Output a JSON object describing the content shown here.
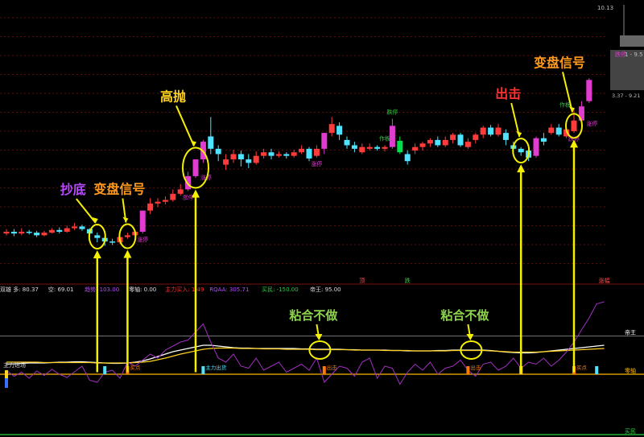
{
  "chart_data": [
    {
      "type": "candlestick",
      "panel": "price",
      "top_right_price": "10.13",
      "axis_box_text": "3.37 - 9.21",
      "axis_box_tag": "跌停",
      "axis_box_value": "1 - 9.5",
      "candles": [
        {
          "o": 9.0,
          "c": 9.02,
          "h": 9.05,
          "l": 8.98
        },
        {
          "o": 9.02,
          "c": 9.0,
          "h": 9.05,
          "l": 8.97
        },
        {
          "o": 9.0,
          "c": 9.02,
          "h": 9.06,
          "l": 8.98
        },
        {
          "o": 9.02,
          "c": 9.01,
          "h": 9.04,
          "l": 8.99
        },
        {
          "o": 9.01,
          "c": 8.98,
          "h": 9.03,
          "l": 8.96
        },
        {
          "o": 8.98,
          "c": 9.01,
          "h": 9.03,
          "l": 8.97
        },
        {
          "o": 9.01,
          "c": 9.04,
          "h": 9.06,
          "l": 9.0
        },
        {
          "o": 9.04,
          "c": 9.02,
          "h": 9.07,
          "l": 9.0
        },
        {
          "o": 9.02,
          "c": 9.06,
          "h": 9.09,
          "l": 9.01
        },
        {
          "o": 9.06,
          "c": 9.08,
          "h": 9.12,
          "l": 9.04
        },
        {
          "o": 9.08,
          "c": 9.05,
          "h": 9.1,
          "l": 9.03
        },
        {
          "o": 9.05,
          "c": 9.0,
          "h": 9.06,
          "l": 8.96
        },
        {
          "o": 8.98,
          "c": 8.95,
          "h": 9.01,
          "l": 8.9
        },
        {
          "o": 8.95,
          "c": 8.91,
          "h": 8.97,
          "l": 8.86
        },
        {
          "o": 8.91,
          "c": 8.9,
          "h": 8.94,
          "l": 8.87
        },
        {
          "o": 8.9,
          "c": 8.96,
          "h": 8.98,
          "l": 8.88
        },
        {
          "o": 8.96,
          "c": 8.98,
          "h": 9.01,
          "l": 8.94
        },
        {
          "o": 8.98,
          "c": 9.02,
          "h": 9.04,
          "l": 8.96
        },
        {
          "o": 9.02,
          "c": 9.26,
          "h": 9.26,
          "l": 9.0
        },
        {
          "o": 9.26,
          "c": 9.34,
          "h": 9.4,
          "l": 9.22
        },
        {
          "o": 9.34,
          "c": 9.36,
          "h": 9.4,
          "l": 9.3
        },
        {
          "o": 9.36,
          "c": 9.38,
          "h": 9.42,
          "l": 9.33
        },
        {
          "o": 9.38,
          "c": 9.45,
          "h": 9.5,
          "l": 9.36
        },
        {
          "o": 9.45,
          "c": 9.5,
          "h": 9.56,
          "l": 9.43
        },
        {
          "o": 9.5,
          "c": 9.65,
          "h": 9.7,
          "l": 9.48
        },
        {
          "o": 9.65,
          "c": 9.84,
          "h": 9.84,
          "l": 9.63
        },
        {
          "o": 9.84,
          "c": 10.04,
          "h": 10.06,
          "l": 9.8
        },
        {
          "o": 10.1,
          "c": 9.96,
          "h": 10.32,
          "l": 9.9
        },
        {
          "o": 9.96,
          "c": 9.9,
          "h": 10.0,
          "l": 9.82
        },
        {
          "o": 9.78,
          "c": 9.84,
          "h": 9.9,
          "l": 9.72
        },
        {
          "o": 9.84,
          "c": 9.9,
          "h": 9.95,
          "l": 9.8
        },
        {
          "o": 9.9,
          "c": 9.84,
          "h": 9.94,
          "l": 9.76
        },
        {
          "o": 9.84,
          "c": 9.8,
          "h": 9.9,
          "l": 9.74
        },
        {
          "o": 9.8,
          "c": 9.88,
          "h": 9.93,
          "l": 9.78
        },
        {
          "o": 9.88,
          "c": 9.92,
          "h": 9.96,
          "l": 9.85
        },
        {
          "o": 9.92,
          "c": 9.88,
          "h": 9.96,
          "l": 9.84
        },
        {
          "o": 9.88,
          "c": 9.9,
          "h": 9.93,
          "l": 9.86
        },
        {
          "o": 9.9,
          "c": 9.88,
          "h": 9.92,
          "l": 9.85
        },
        {
          "o": 9.88,
          "c": 9.92,
          "h": 9.95,
          "l": 9.86
        },
        {
          "o": 9.92,
          "c": 9.96,
          "h": 10.0,
          "l": 9.9
        },
        {
          "o": 9.96,
          "c": 9.85,
          "h": 9.98,
          "l": 9.82
        },
        {
          "o": 9.88,
          "c": 9.96,
          "h": 10.0,
          "l": 9.86
        },
        {
          "o": 9.96,
          "c": 10.14,
          "h": 10.14,
          "l": 9.9
        },
        {
          "o": 10.14,
          "c": 10.24,
          "h": 10.32,
          "l": 10.1
        },
        {
          "o": 10.22,
          "c": 10.12,
          "h": 10.26,
          "l": 10.06
        },
        {
          "o": 10.06,
          "c": 10.0,
          "h": 10.1,
          "l": 9.96
        },
        {
          "o": 10.0,
          "c": 9.96,
          "h": 10.04,
          "l": 9.92
        },
        {
          "o": 9.92,
          "c": 9.98,
          "h": 10.02,
          "l": 9.9
        },
        {
          "o": 9.96,
          "c": 9.98,
          "h": 10.02,
          "l": 9.94
        },
        {
          "o": 9.98,
          "c": 9.96,
          "h": 10.0,
          "l": 9.94
        },
        {
          "o": 9.96,
          "c": 9.98,
          "h": 10.0,
          "l": 9.93
        },
        {
          "o": 9.98,
          "c": 10.22,
          "h": 10.3,
          "l": 9.96
        },
        {
          "o": 10.05,
          "c": 9.92,
          "h": 10.1,
          "l": 9.9
        },
        {
          "o": 9.9,
          "c": 9.82,
          "h": 9.94,
          "l": 9.78
        },
        {
          "o": 9.94,
          "c": 9.98,
          "h": 10.02,
          "l": 9.9
        },
        {
          "o": 9.98,
          "c": 10.02,
          "h": 10.04,
          "l": 9.94
        },
        {
          "o": 10.02,
          "c": 10.06,
          "h": 10.08,
          "l": 9.98
        },
        {
          "o": 10.06,
          "c": 10.0,
          "h": 10.1,
          "l": 9.98
        },
        {
          "o": 10.0,
          "c": 10.06,
          "h": 10.1,
          "l": 9.98
        },
        {
          "o": 10.06,
          "c": 10.12,
          "h": 10.14,
          "l": 10.02
        },
        {
          "o": 10.12,
          "c": 10.0,
          "h": 10.14,
          "l": 9.98
        },
        {
          "o": 9.98,
          "c": 10.04,
          "h": 10.08,
          "l": 9.96
        },
        {
          "o": 10.06,
          "c": 10.12,
          "h": 10.14,
          "l": 10.02
        },
        {
          "o": 10.12,
          "c": 10.2,
          "h": 10.22,
          "l": 10.08
        },
        {
          "o": 10.2,
          "c": 10.12,
          "h": 10.23,
          "l": 10.1
        },
        {
          "o": 10.12,
          "c": 10.2,
          "h": 10.24,
          "l": 10.1
        },
        {
          "o": 10.14,
          "c": 10.06,
          "h": 10.18,
          "l": 10.0
        },
        {
          "o": 10.0,
          "c": 9.96,
          "h": 10.04,
          "l": 9.92
        },
        {
          "o": 9.96,
          "c": 9.92,
          "h": 9.98,
          "l": 9.88
        },
        {
          "o": 9.94,
          "c": 9.86,
          "h": 9.98,
          "l": 9.82
        },
        {
          "o": 9.88,
          "c": 10.08,
          "h": 10.1,
          "l": 9.86
        },
        {
          "o": 10.08,
          "c": 10.04,
          "h": 10.14,
          "l": 10.0
        },
        {
          "o": 10.14,
          "c": 10.2,
          "h": 10.24,
          "l": 10.12
        },
        {
          "o": 10.2,
          "c": 10.12,
          "h": 10.24,
          "l": 10.1
        },
        {
          "o": 10.1,
          "c": 10.18,
          "h": 10.22,
          "l": 10.08
        },
        {
          "o": 10.16,
          "c": 10.28,
          "h": 10.4,
          "l": 10.14
        },
        {
          "o": 10.28,
          "c": 10.44,
          "h": 10.5,
          "l": 10.24
        },
        {
          "o": 10.5,
          "c": 10.74,
          "h": 10.76,
          "l": 10.48
        }
      ],
      "labels": [
        {
          "i": 18,
          "text": "涨停",
          "pos": "below",
          "color": "#e23bd0"
        },
        {
          "i": 24,
          "text": "涨停",
          "pos": "below",
          "color": "#e23bd0"
        },
        {
          "i": 25,
          "text": "涨停",
          "pos": "right",
          "color": "#e23bd0"
        },
        {
          "i": 41,
          "text": "涨停",
          "pos": "below",
          "color": "#e23bd0"
        },
        {
          "i": 50,
          "text": "作板",
          "pos": "above",
          "color": "#2ecc40"
        },
        {
          "i": 51,
          "text": "跌停",
          "pos": "above",
          "color": "#2ecc40"
        },
        {
          "i": 75,
          "text": "作板",
          "pos": "left",
          "color": "#2ecc40"
        },
        {
          "i": 75,
          "text": "跌停",
          "pos": "below",
          "color": "#e23bd0"
        },
        {
          "i": 76,
          "text": "涨停",
          "pos": "right",
          "color": "#e23bd0"
        }
      ],
      "annotations": [
        {
          "text": "抄底",
          "color": "#b84bff",
          "i": 12
        },
        {
          "text": "变盘信号",
          "color": "#ff9a1f",
          "i": 16
        },
        {
          "text": "高抛",
          "color": "#ffd21f",
          "i": 25
        },
        {
          "text": "出击",
          "color": "#ff3030",
          "i": 68
        },
        {
          "text": "变盘信号",
          "color": "#ff9a1f",
          "i": 75
        }
      ],
      "markers": [
        {
          "text": "顶",
          "i": 47,
          "color": "#ff5050"
        },
        {
          "text": "跌",
          "i": 53,
          "color": "#2ecc40"
        },
        {
          "text": "涨幅",
          "i": 79,
          "color": "#ff5050"
        }
      ]
    },
    {
      "type": "line",
      "panel": "indicator",
      "legend": [
        {
          "text": "双雄 多: 80.37",
          "color": "#dddddd"
        },
        {
          "text": "空: 69.01",
          "color": "#dddddd"
        },
        {
          "text": "趋势: 103.00",
          "color": "#b84bff"
        },
        {
          "text": "零轴: 0.00",
          "color": "#dddddd"
        },
        {
          "text": "主力买入: 1.49",
          "color": "#ff3030"
        },
        {
          "text": "RQAA: 305.71",
          "color": "#b84bff"
        },
        {
          "text": "买民: -150.00",
          "color": "#2ecc40"
        },
        {
          "text": "帝王: 95.00",
          "color": "#dddddd"
        }
      ],
      "ylim": [
        -150,
        200
      ],
      "level_lines": [
        {
          "value": 95,
          "label": "帝王",
          "color": "#ffffff"
        },
        {
          "value": 0,
          "label": "零轴",
          "color": "#ffb300"
        },
        {
          "value": -150,
          "label": "买民",
          "color": "#2ecc40"
        }
      ],
      "series": [
        {
          "name": "多",
          "color": "#ffffff",
          "values": [
            25,
            26,
            27,
            28,
            28,
            28,
            29,
            30,
            30,
            31,
            31,
            30,
            29,
            28,
            27,
            27,
            28,
            30,
            33,
            38,
            44,
            50,
            56,
            60,
            64,
            68,
            72,
            72,
            70,
            68,
            66,
            65,
            65,
            64,
            64,
            64,
            64,
            64,
            64,
            63,
            63,
            62,
            62,
            62,
            62,
            61,
            61,
            60,
            60,
            60,
            60,
            59,
            59,
            58,
            58,
            58,
            58,
            59,
            59,
            60,
            60,
            60,
            60,
            60,
            59,
            57,
            55,
            54,
            53,
            53,
            54,
            56,
            58,
            60,
            62,
            64,
            66,
            68,
            70,
            72
          ]
        },
        {
          "name": "空",
          "color": "#ffd21f",
          "values": [
            30,
            30,
            30,
            30,
            30,
            29,
            29,
            29,
            29,
            29,
            29,
            29,
            28,
            28,
            28,
            28,
            28,
            29,
            30,
            32,
            36,
            40,
            45,
            50,
            54,
            58,
            62,
            64,
            65,
            65,
            65,
            64,
            64,
            64,
            63,
            63,
            63,
            62,
            62,
            62,
            62,
            61,
            61,
            61,
            61,
            61,
            60,
            60,
            60,
            60,
            59,
            59,
            59,
            59,
            58,
            58,
            58,
            58,
            58,
            59,
            59,
            59,
            59,
            59,
            58,
            57,
            56,
            55,
            55,
            55,
            55,
            56,
            57,
            58,
            59,
            60,
            61,
            62,
            63,
            64
          ]
        },
        {
          "name": "RQAA",
          "color": "#a12fc0",
          "values": [
            10,
            -5,
            5,
            -10,
            8,
            -3,
            12,
            0,
            -8,
            6,
            20,
            -15,
            -20,
            5,
            10,
            -10,
            30,
            20,
            35,
            50,
            40,
            60,
            70,
            80,
            85,
            105,
            125,
            80,
            40,
            30,
            50,
            20,
            15,
            40,
            10,
            20,
            30,
            5,
            15,
            25,
            10,
            40,
            -20,
            0,
            20,
            15,
            -5,
            30,
            40,
            -10,
            20,
            15,
            -25,
            5,
            25,
            10,
            30,
            0,
            15,
            20,
            35,
            10,
            -5,
            25,
            30,
            10,
            20,
            40,
            15,
            30,
            25,
            40,
            20,
            35,
            55,
            80,
            110,
            140,
            175,
            180
          ]
        }
      ],
      "signals": [
        {
          "i": 13,
          "label": "",
          "color": "#4fe3ff"
        },
        {
          "i": 16,
          "label": "买点",
          "color": "#ff7a00"
        },
        {
          "i": 26,
          "label": "主力出货",
          "color": "#4fe3ff"
        },
        {
          "i": 42,
          "label": "出击",
          "color": "#ff7a00"
        },
        {
          "i": 61,
          "label": "出击",
          "color": "#ff7a00"
        },
        {
          "i": 68,
          "label": "",
          "color": "#ffd21f"
        },
        {
          "i": 75,
          "label": "买点",
          "color": "#ff7a00"
        },
        {
          "i": 78,
          "label": "",
          "color": "#4fe3ff"
        }
      ],
      "left_label": "主力进场",
      "annotations": [
        {
          "text": "粘合不做",
          "color": "#8bd34a",
          "i": 41
        },
        {
          "text": "粘合不做",
          "color": "#8bd34a",
          "i": 61
        }
      ]
    }
  ]
}
